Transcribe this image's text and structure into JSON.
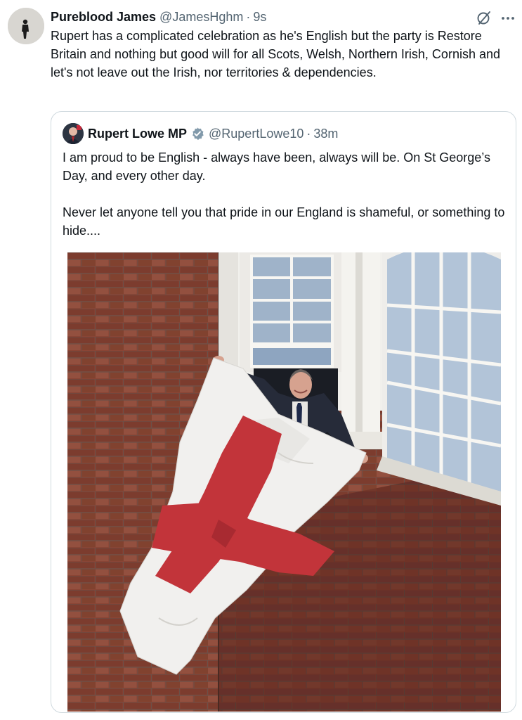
{
  "tweet": {
    "author_name": "Pureblood James",
    "author_handle": "@JamesHghm",
    "separator": "·",
    "time": "9s",
    "text": "Rupert has a complicated celebration as he's English but the party is Restore Britain and nothing but good will for all Scots, Welsh, Northern Irish, Cornish and let's not leave out the Irish, nor territories & dependencies.",
    "icons": [
      "avatar",
      "grok-icon",
      "more-icon"
    ]
  },
  "quoted_tweet": {
    "author_name": "Rupert Lowe MP",
    "verified": true,
    "author_handle": "@RupertLowe10",
    "separator": "·",
    "time": "38m",
    "text": "I am proud to be English - always have been, always will be. On St George’s Day, and every other day.\n\nNever let anyone tell you that pride in our England is shameful, or something to hide....",
    "media": "photo",
    "colors": {
      "brick": "#8a4535",
      "flag_white": "#f1f0ee",
      "flag_red": "#c2343a",
      "window_frame": "#f3f2ee",
      "verified_badge": "#829aab"
    }
  }
}
